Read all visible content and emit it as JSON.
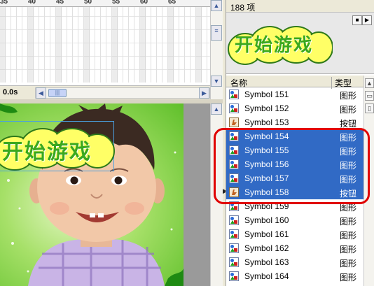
{
  "timeline": {
    "ruler_labels": [
      "35",
      "40",
      "45",
      "50",
      "55",
      "60",
      "65"
    ],
    "time": "0.0s"
  },
  "stage": {
    "banner_text": "开始游戏"
  },
  "library": {
    "item_count": "188 项",
    "preview_text": "开始游戏",
    "header": {
      "name": "名称",
      "type": "类型"
    },
    "items": [
      {
        "name": "Symbol 151",
        "type": "图形",
        "kind": "graphic",
        "selected": false
      },
      {
        "name": "Symbol 152",
        "type": "图形",
        "kind": "graphic",
        "selected": false
      },
      {
        "name": "Symbol 153",
        "type": "按钮",
        "kind": "button",
        "selected": false
      },
      {
        "name": "Symbol 154",
        "type": "图形",
        "kind": "graphic",
        "selected": true
      },
      {
        "name": "Symbol 155",
        "type": "图形",
        "kind": "graphic",
        "selected": true
      },
      {
        "name": "Symbol 156",
        "type": "图形",
        "kind": "graphic",
        "selected": true
      },
      {
        "name": "Symbol 157",
        "type": "图形",
        "kind": "graphic",
        "selected": true
      },
      {
        "name": "Symbol 158",
        "type": "按钮",
        "kind": "button",
        "selected": true
      },
      {
        "name": "Symbol 159",
        "type": "图形",
        "kind": "graphic",
        "selected": false
      },
      {
        "name": "Symbol 160",
        "type": "图形",
        "kind": "graphic",
        "selected": false
      },
      {
        "name": "Symbol 161",
        "type": "图形",
        "kind": "graphic",
        "selected": false
      },
      {
        "name": "Symbol 162",
        "type": "图形",
        "kind": "graphic",
        "selected": false
      },
      {
        "name": "Symbol 163",
        "type": "图形",
        "kind": "graphic",
        "selected": false
      },
      {
        "name": "Symbol 164",
        "type": "图形",
        "kind": "graphic",
        "selected": false
      }
    ]
  },
  "colors": {
    "selection": "#316ac5",
    "highlight_ring": "#e00000",
    "banner_fill": "#ffff66",
    "banner_text": "#3aa81e"
  }
}
